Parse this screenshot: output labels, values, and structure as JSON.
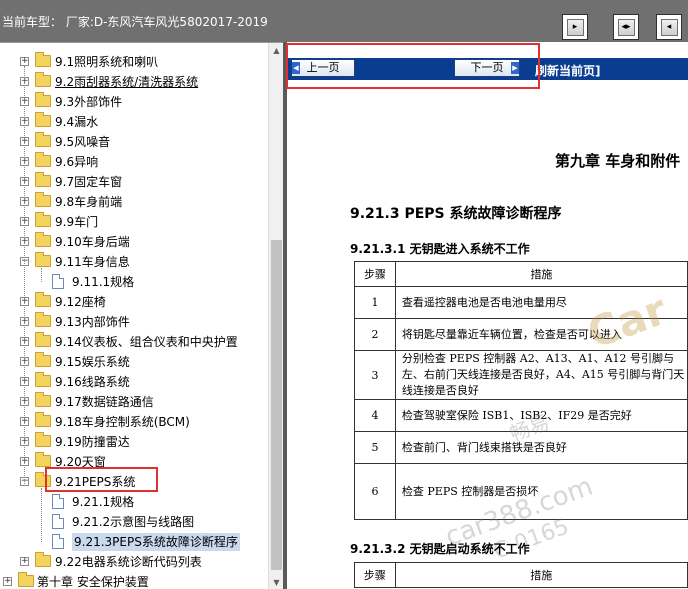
{
  "header": {
    "vehicle_info": "当前车型： 厂家:D-东风汽车风光5802017-2019",
    "buttons": [
      {
        "name": "toolbar-button-1",
        "glyph": "▸"
      },
      {
        "name": "toolbar-button-2",
        "glyph": "◂▸"
      },
      {
        "name": "toolbar-button-3",
        "glyph": "◂"
      }
    ]
  },
  "tree": {
    "items": [
      {
        "label": "9.1照明系统和喇叭",
        "type": "folder",
        "level": 1,
        "state": "+"
      },
      {
        "label": "9.2雨刮器系统/清洗器系统",
        "type": "folder",
        "level": 1,
        "state": "+",
        "link": true
      },
      {
        "label": "9.3外部饰件",
        "type": "folder",
        "level": 1,
        "state": "+"
      },
      {
        "label": "9.4漏水",
        "type": "folder",
        "level": 1,
        "state": "+"
      },
      {
        "label": "9.5风噪音",
        "type": "folder",
        "level": 1,
        "state": "+"
      },
      {
        "label": "9.6异响",
        "type": "folder",
        "level": 1,
        "state": "+"
      },
      {
        "label": "9.7固定车窗",
        "type": "folder",
        "level": 1,
        "state": "+"
      },
      {
        "label": "9.8车身前端",
        "type": "folder",
        "level": 1,
        "state": "+"
      },
      {
        "label": "9.9车门",
        "type": "folder",
        "level": 1,
        "state": "+"
      },
      {
        "label": "9.10车身后端",
        "type": "folder",
        "level": 1,
        "state": "+"
      },
      {
        "label": "9.11车身信息",
        "type": "folder",
        "level": 1,
        "state": "-"
      },
      {
        "label": "9.11.1规格",
        "type": "doc",
        "level": 2
      },
      {
        "label": "9.12座椅",
        "type": "folder",
        "level": 1,
        "state": "+"
      },
      {
        "label": "9.13内部饰件",
        "type": "folder",
        "level": 1,
        "state": "+"
      },
      {
        "label": "9.14仪表板、组合仪表和中央护置",
        "type": "folder",
        "level": 1,
        "state": "+"
      },
      {
        "label": "9.15娱乐系统",
        "type": "folder",
        "level": 1,
        "state": "+"
      },
      {
        "label": "9.16线路系统",
        "type": "folder",
        "level": 1,
        "state": "+"
      },
      {
        "label": "9.17数据链路通信",
        "type": "folder",
        "level": 1,
        "state": "+"
      },
      {
        "label": "9.18车身控制系统(BCM)",
        "type": "folder",
        "level": 1,
        "state": "+"
      },
      {
        "label": "9.19防撞雷达",
        "type": "folder",
        "level": 1,
        "state": "+"
      },
      {
        "label": "9.20天窗",
        "type": "folder",
        "level": 1,
        "state": "+"
      },
      {
        "label": "9.21PEPS系统",
        "type": "folder",
        "level": 1,
        "state": "-"
      },
      {
        "label": "9.21.1规格",
        "type": "doc",
        "level": 2
      },
      {
        "label": "9.21.2示意图与线路图",
        "type": "doc",
        "level": 2
      },
      {
        "label": "9.21.3PEPS系统故障诊断程序",
        "type": "doc",
        "level": 2,
        "selected": true
      },
      {
        "label": "9.22电器系统诊断代码列表",
        "type": "folder",
        "level": 1,
        "state": "+"
      },
      {
        "label": "第十章 安全保护装置",
        "type": "folder",
        "level": 0,
        "state": "+"
      }
    ]
  },
  "viewer": {
    "nav": {
      "prev_label": "上一页",
      "next_label": "下一页",
      "refresh_label": "刷新当前页]"
    },
    "chapter_title": "第九章  车身和附件",
    "section_title": "9.21.3 PEPS 系统故障诊断程序",
    "subsection_1": "9.21.3.1 无钥匙进入系统不工作",
    "subsection_2": "9.21.3.2 无钥匙启动系统不工作",
    "table": {
      "headers": [
        "步骤",
        "措施"
      ],
      "rows": [
        {
          "step": "1",
          "measure": "查看遥控器电池是否电池电量用尽"
        },
        {
          "step": "2",
          "measure": "将钥匙尽量靠近车辆位置，检查是否可以进入"
        },
        {
          "step": "3",
          "measure": "分别检查 PEPS 控制器 A2、A13、A1、A12 号引脚与左、右前门天线连接是否良好，A4、A15 号引脚与背门天线连接是否良好"
        },
        {
          "step": "4",
          "measure": "检查驾驶室保险 ISB1、ISB2、IF29 是否完好"
        },
        {
          "step": "5",
          "measure": "检查前门、背门线束搭铁是否良好"
        },
        {
          "step": "6",
          "measure": "检查 PEPS 控制器是否损坏"
        }
      ]
    },
    "watermark": [
      "Car",
      "畅易",
      "car388.com",
      "C    0165"
    ]
  }
}
